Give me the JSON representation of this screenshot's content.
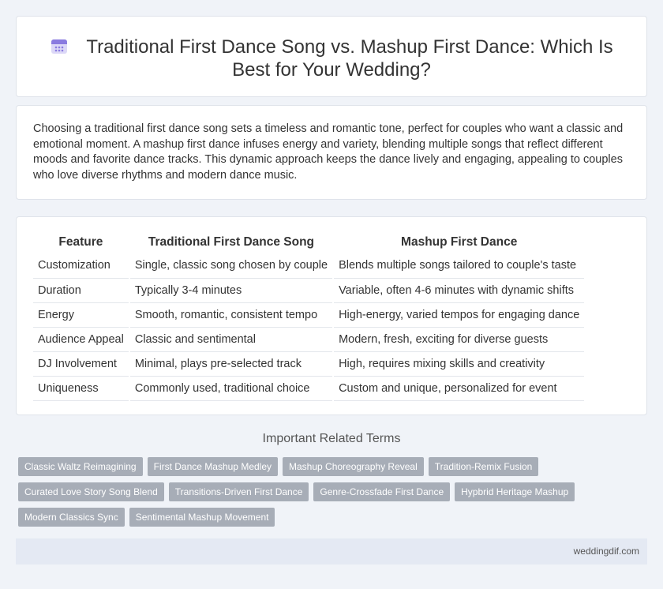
{
  "header": {
    "icon": "calendar-icon",
    "title": "Traditional First Dance Song vs. Mashup First Dance: Which Is Best for Your Wedding?"
  },
  "intro": {
    "text": "Choosing a traditional first dance song sets a timeless and romantic tone, perfect for couples who want a classic and emotional moment. A mashup first dance infuses energy and variety, blending multiple songs that reflect different moods and favorite dance tracks. This dynamic approach keeps the dance lively and engaging, appealing to couples who love diverse rhythms and modern dance music."
  },
  "comparison": {
    "headers": [
      "Feature",
      "Traditional First Dance Song",
      "Mashup First Dance"
    ],
    "rows": [
      [
        "Customization",
        "Single, classic song chosen by couple",
        "Blends multiple songs tailored to couple's taste"
      ],
      [
        "Duration",
        "Typically 3-4 minutes",
        "Variable, often 4-6 minutes with dynamic shifts"
      ],
      [
        "Energy",
        "Smooth, romantic, consistent tempo",
        "High-energy, varied tempos for engaging dance"
      ],
      [
        "Audience Appeal",
        "Classic and sentimental",
        "Modern, fresh, exciting for diverse guests"
      ],
      [
        "DJ Involvement",
        "Minimal, plays pre-selected track",
        "High, requires mixing skills and creativity"
      ],
      [
        "Uniqueness",
        "Commonly used, traditional choice",
        "Custom and unique, personalized for event"
      ]
    ]
  },
  "related": {
    "title": "Important Related Terms",
    "rows": [
      [
        "Classic Waltz Reimagining",
        "First Dance Mashup Medley",
        "Mashup Choreography Reveal",
        "Tradition-Remix Fusion"
      ],
      [
        "Curated Love Story Song Blend",
        "Transitions-Driven First Dance",
        "Genre-Crossfade First Dance",
        "Hypbrid Heritage Mashup"
      ],
      [
        "Modern Classics Sync",
        "Sentimental Mashup Movement"
      ]
    ]
  },
  "footer": {
    "site": "weddingdif.com"
  },
  "colors": {
    "background": "#f0f3f8",
    "tag": "#a7adb7",
    "footer": "#e4e9f3",
    "icon_accent": "#8a7be0"
  }
}
